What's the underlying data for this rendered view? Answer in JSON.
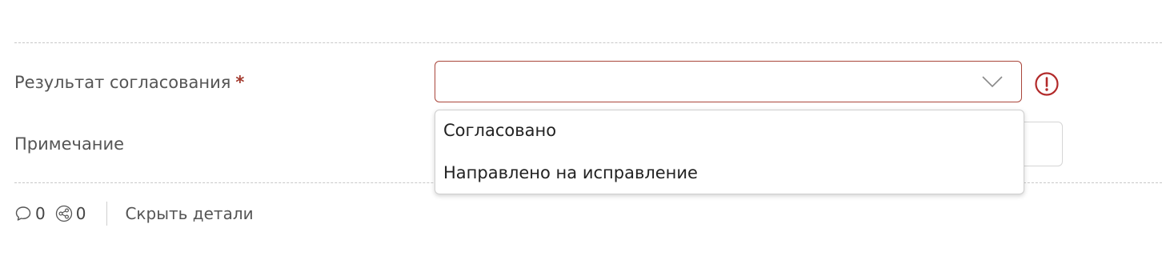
{
  "form": {
    "result_label": "Результат согласования",
    "required_mark": "*",
    "note_label": "Примечание",
    "result_select": {
      "value": "",
      "state": "error",
      "border_color": "#a9453a",
      "chevron_icon": "chevron-down-icon",
      "error_icon": "alert-circle-icon",
      "error_color": "#b22a2a"
    },
    "dropdown": {
      "options": [
        {
          "label": "Согласовано"
        },
        {
          "label": "Направлено на исправление"
        }
      ]
    }
  },
  "footer": {
    "comments_icon": "comment-icon",
    "comments_count": "0",
    "shares_icon": "share-icon",
    "shares_count": "0",
    "hide_details_label": "Скрыть детали"
  }
}
